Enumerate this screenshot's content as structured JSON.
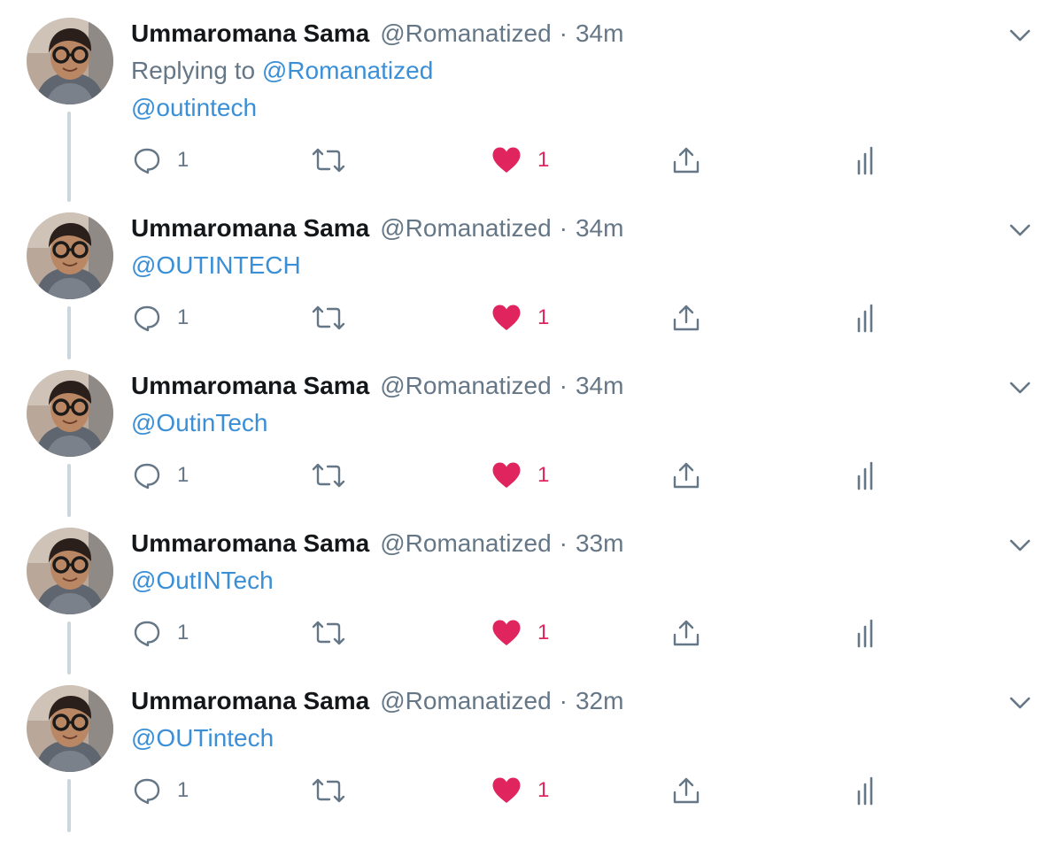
{
  "colors": {
    "link": "#3b8fd6",
    "muted": "#657786",
    "like": "#e0245e",
    "thread_line": "#ccd6dd"
  },
  "icons": {
    "reply": "reply-icon",
    "retweet": "retweet-icon",
    "like": "heart-icon",
    "share": "share-icon",
    "analytics": "analytics-icon",
    "menu": "chevron-down-icon"
  },
  "tweets": [
    {
      "name": "Ummaromana Sama",
      "handle": "@Romanatized",
      "separator": "·",
      "time": "34m",
      "replying_prefix": "Replying to ",
      "replying_to": "@Romanatized",
      "text": "@outintech",
      "reply_count": "1",
      "like_count": "1"
    },
    {
      "name": "Ummaromana Sama",
      "handle": "@Romanatized",
      "separator": "·",
      "time": "34m",
      "text": "@OUTINTECH",
      "reply_count": "1",
      "like_count": "1"
    },
    {
      "name": "Ummaromana Sama",
      "handle": "@Romanatized",
      "separator": "·",
      "time": "34m",
      "text": "@OutinTech",
      "reply_count": "1",
      "like_count": "1"
    },
    {
      "name": "Ummaromana Sama",
      "handle": "@Romanatized",
      "separator": "·",
      "time": "33m",
      "text": "@OutINTech",
      "reply_count": "1",
      "like_count": "1"
    },
    {
      "name": "Ummaromana Sama",
      "handle": "@Romanatized",
      "separator": "·",
      "time": "32m",
      "text": "@OUTintech",
      "reply_count": "1",
      "like_count": "1"
    }
  ]
}
